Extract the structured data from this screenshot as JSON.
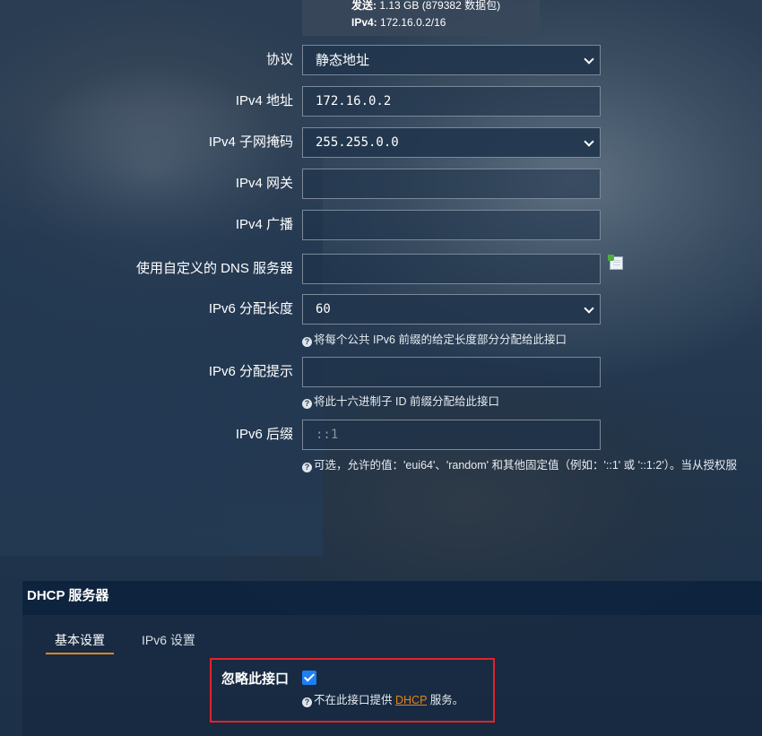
{
  "stats": {
    "sent_label": "发送:",
    "sent_value": "1.13 GB (879382 数据包)",
    "ipv4_label": "IPv4:",
    "ipv4_value": "172.16.0.2/16"
  },
  "form": {
    "protocol": {
      "label": "协议",
      "value": "静态地址"
    },
    "ipv4_address": {
      "label": "IPv4 地址",
      "value": "172.16.0.2"
    },
    "ipv4_netmask": {
      "label": "IPv4 子网掩码",
      "value": "255.255.0.0"
    },
    "ipv4_gateway": {
      "label": "IPv4 网关",
      "value": ""
    },
    "ipv4_broadcast": {
      "label": "IPv4 广播",
      "value": ""
    },
    "custom_dns": {
      "label": "使用自定义的 DNS 服务器",
      "value": ""
    },
    "ipv6_assign_length": {
      "label": "IPv6 分配长度",
      "value": "60",
      "hint": "将每个公共 IPv6 前缀的给定长度部分分配给此接口"
    },
    "ipv6_assign_hint": {
      "label": "IPv6 分配提示",
      "value": "",
      "hint": "将此十六进制子 ID 前缀分配给此接口"
    },
    "ipv6_suffix": {
      "label": "IPv6 后缀",
      "placeholder": "::1",
      "hint": "可选，允许的值：'eui64'、'random' 和其他固定值（例如：'::1' 或 '::1:2'）。当从授权服"
    }
  },
  "dhcp": {
    "title": "DHCP 服务器",
    "tabs": [
      {
        "label": "基本设置",
        "active": true
      },
      {
        "label": "IPv6 设置",
        "active": false
      }
    ],
    "ignore_interface": {
      "label": "忽略此接口",
      "checked": true,
      "hint_before": "不在此接口提供",
      "hint_link": "DHCP",
      "hint_after": "服务。"
    }
  },
  "colors": {
    "accent": "#e2851d",
    "checkbox": "#1e7ff2",
    "highlight_border": "#e3222a"
  }
}
